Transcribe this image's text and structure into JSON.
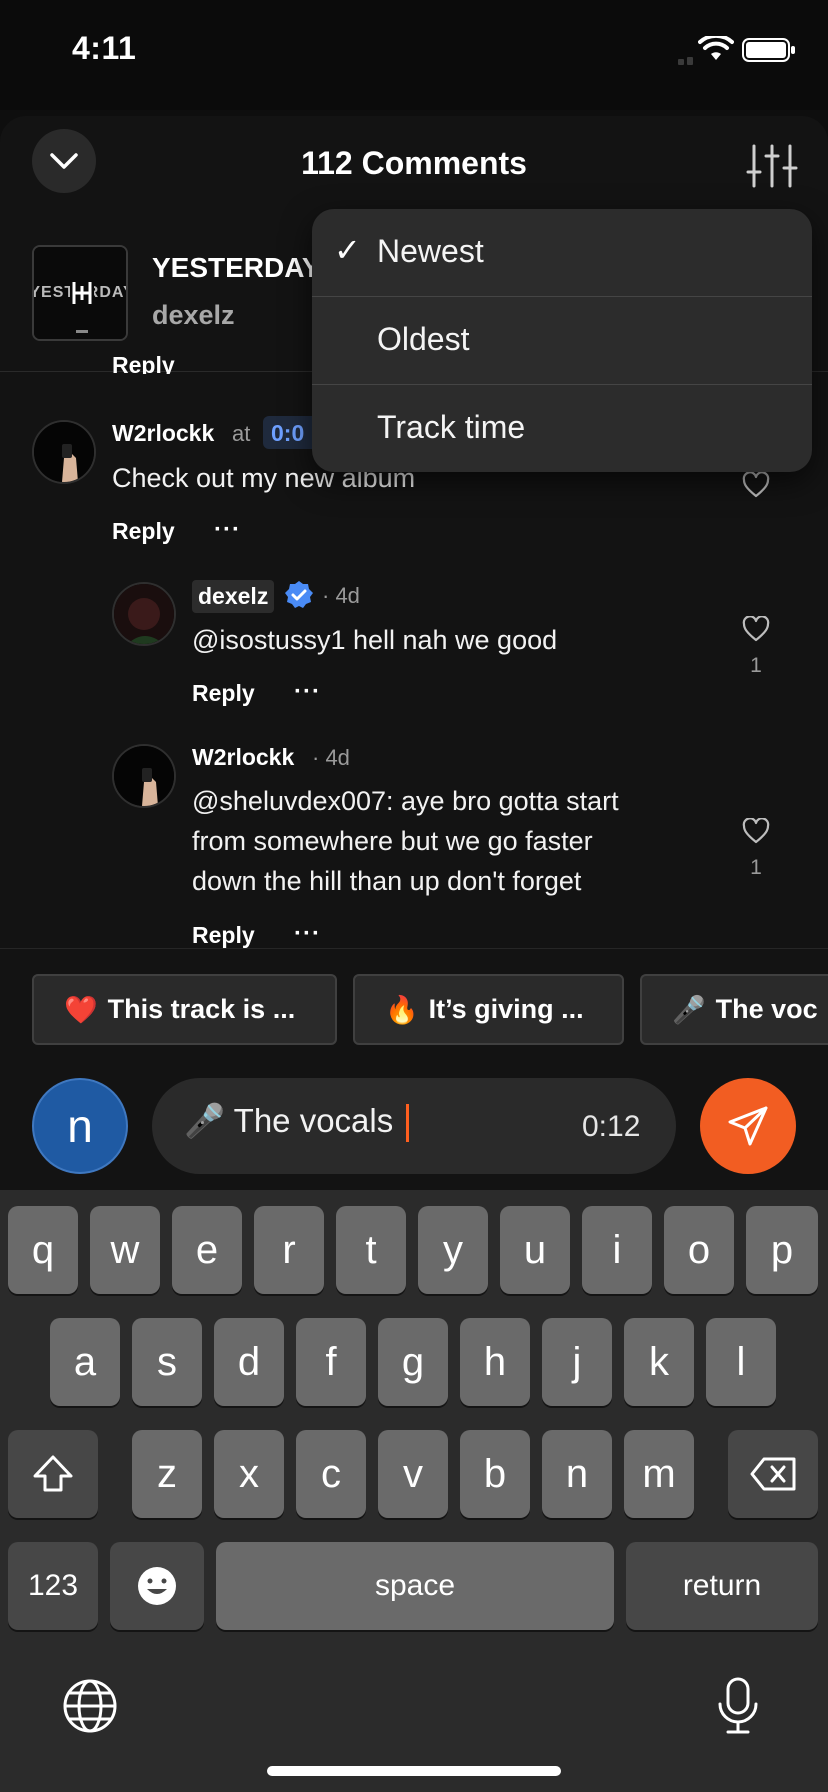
{
  "status_bar": {
    "time": "4:11"
  },
  "header": {
    "title": "112 Comments"
  },
  "track": {
    "title": "YESTERDAY",
    "artist": "dexelz",
    "art_text": "YESTERDAY"
  },
  "comments": [
    {
      "reply_label": "Reply"
    },
    {
      "username": "W2rlockk",
      "at_label": "at",
      "track_time": "0:0",
      "text": "Check out my new album",
      "reply_label": "Reply",
      "more_label": "···"
    },
    {
      "username": "dexelz",
      "verified": true,
      "time": "· 4d",
      "text": "@isostussy1 hell nah we good",
      "likes": "1",
      "reply_label": "Reply",
      "more_label": "···"
    },
    {
      "username": "W2rlockk",
      "time": "· 4d",
      "text_lines": [
        "@sheluvdex007: aye bro gotta start",
        "from somewhere but we go faster",
        "down the hill than up don't forget"
      ],
      "likes": "1",
      "reply_label": "Reply",
      "more_label": "···"
    }
  ],
  "sort_menu": {
    "items": [
      {
        "label": "Newest",
        "checked": true
      },
      {
        "label": "Oldest",
        "checked": false
      },
      {
        "label": "Track time",
        "checked": false
      }
    ],
    "check_glyph": "✓"
  },
  "chips": [
    {
      "emoji": "❤️",
      "label": "This track is ..."
    },
    {
      "emoji": "🔥",
      "label": "It’s giving ..."
    },
    {
      "emoji": "🎤",
      "label": "The voc"
    }
  ],
  "composer": {
    "user_initial": "n",
    "text": "🎤 The vocals",
    "timestamp": "0:12"
  },
  "keyboard": {
    "row1": [
      "q",
      "w",
      "e",
      "r",
      "t",
      "y",
      "u",
      "i",
      "o",
      "p"
    ],
    "row2": [
      "a",
      "s",
      "d",
      "f",
      "g",
      "h",
      "j",
      "k",
      "l"
    ],
    "row3": [
      "z",
      "x",
      "c",
      "v",
      "b",
      "n",
      "m"
    ],
    "numbers_label": "123",
    "space_label": "space",
    "return_label": "return"
  },
  "colors": {
    "accent": "#f25d22",
    "verified": "#4a8bf5",
    "link": "#6ea0ff"
  }
}
